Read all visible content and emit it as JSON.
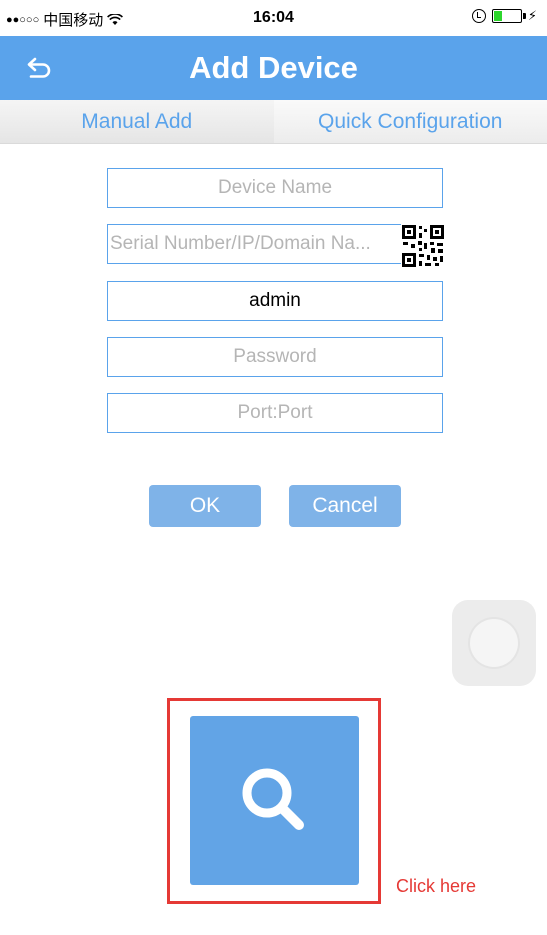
{
  "status_bar": {
    "signal": "●●○○○",
    "carrier": "中国移动",
    "wifi": "詾",
    "time": "16:04",
    "bolt": "⚡"
  },
  "nav": {
    "title": "Add Device",
    "back_icon": "back-arrow-icon"
  },
  "tabs": [
    {
      "label": "Manual Add"
    },
    {
      "label": "Quick Configuration"
    }
  ],
  "form": {
    "device_name_placeholder": "Device Name",
    "serial_placeholder": "Serial Number/IP/Domain Na...",
    "username_value": "admin",
    "password_placeholder": "Password",
    "port_placeholder": "Port:Port",
    "qr_icon": "qr-code-icon"
  },
  "buttons": {
    "ok": "OK",
    "cancel": "Cancel"
  },
  "annotation": {
    "click_here": "Click here",
    "search_icon": "search-icon",
    "highlight_color": "#e53935"
  },
  "colors": {
    "accent": "#5aa3eb",
    "button": "#7fb3e8",
    "search_tile": "#62a4e6"
  }
}
